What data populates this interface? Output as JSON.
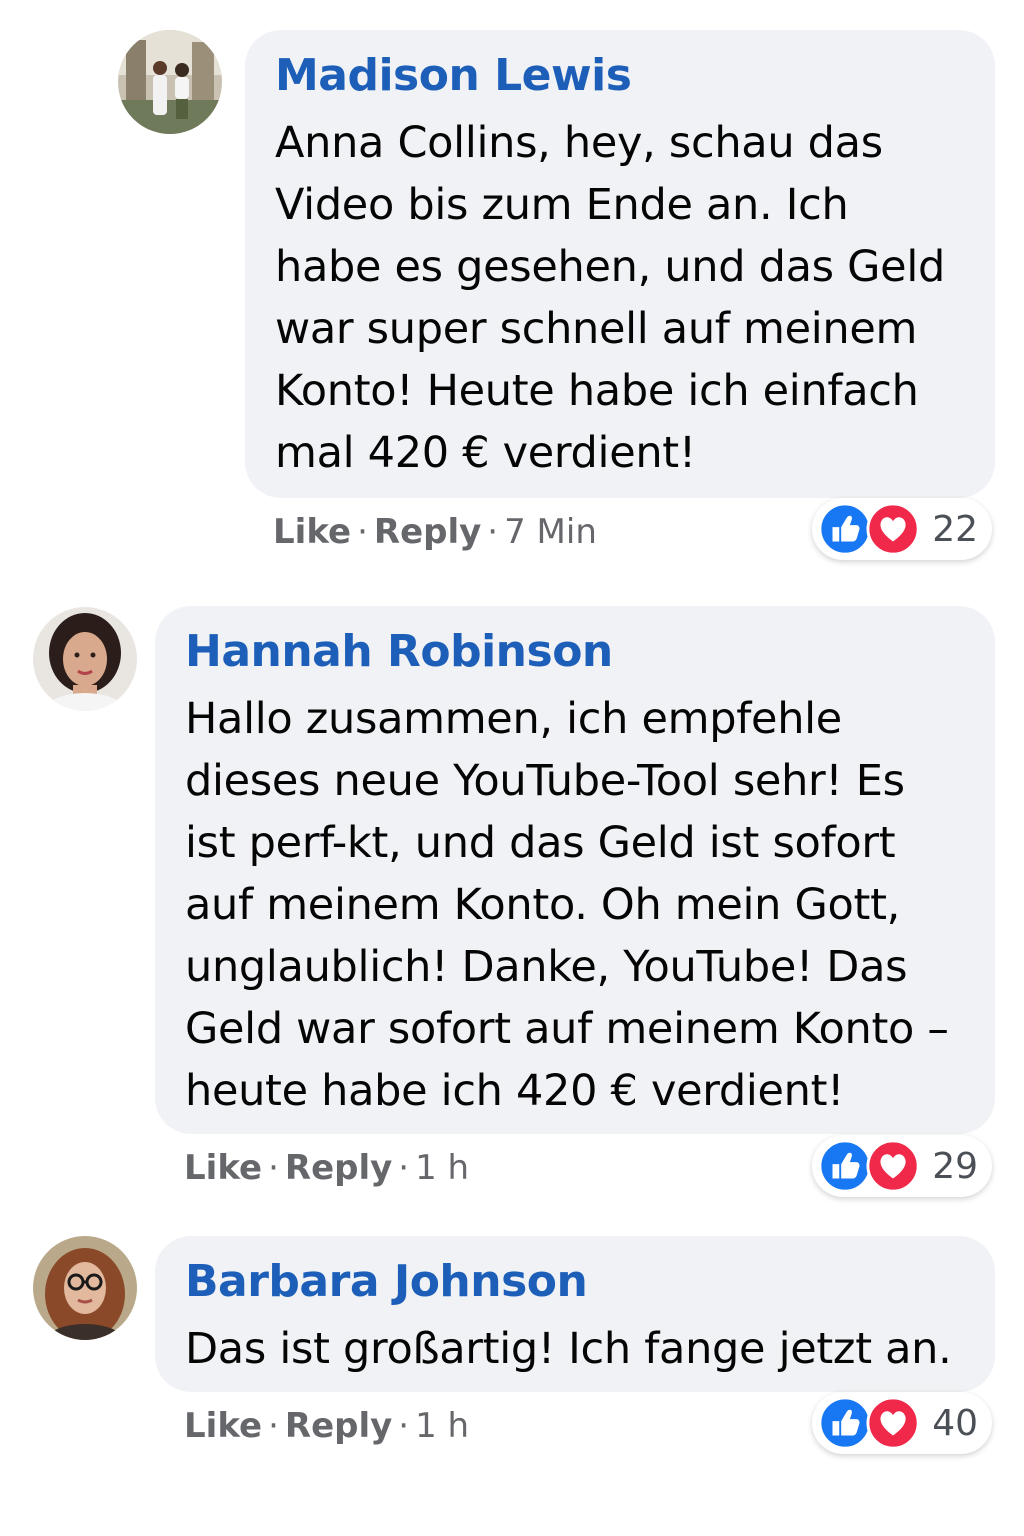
{
  "comments": [
    {
      "author": "Madison Lewis",
      "text": "Anna Collins, hey, schau das Video bis zum Ende an. Ich habe es gesehen, und das Geld war super schnell auf meinem Konto! Heute habe ich einfach mal 420 € verdient!",
      "like_label": "Like",
      "reply_label": "Reply",
      "time": "7 Min",
      "reaction_count": "22",
      "reaction_icons": [
        "like-icon",
        "love-icon"
      ]
    },
    {
      "author": "Hannah Robinson",
      "text": "Hallo zusammen, ich empfehle dieses neue YouTube-Tool sehr! Es ist perf-kt, und das Geld ist sofort auf meinem Konto. Oh mein Gott, unglaublich! Danke, YouTube! Das Geld war sofort auf meinem Konto – heute habe ich 420 € verdient!",
      "like_label": "Like",
      "reply_label": "Reply",
      "time": "1 h",
      "reaction_count": "29",
      "reaction_icons": [
        "like-icon",
        "love-icon"
      ]
    },
    {
      "author": "Barbara Johnson",
      "text": "Das ist großartig! Ich fange jetzt an.",
      "like_label": "Like",
      "reply_label": "Reply",
      "time": "1 h",
      "reaction_count": "40",
      "reaction_icons": [
        "like-icon",
        "love-icon"
      ]
    }
  ],
  "separator": "·",
  "colors": {
    "author": "#1d5fb8",
    "bubble": "#f0f2f5",
    "like_blue": "#1877f2",
    "love_red": "#f02849",
    "meta": "#65676b"
  }
}
